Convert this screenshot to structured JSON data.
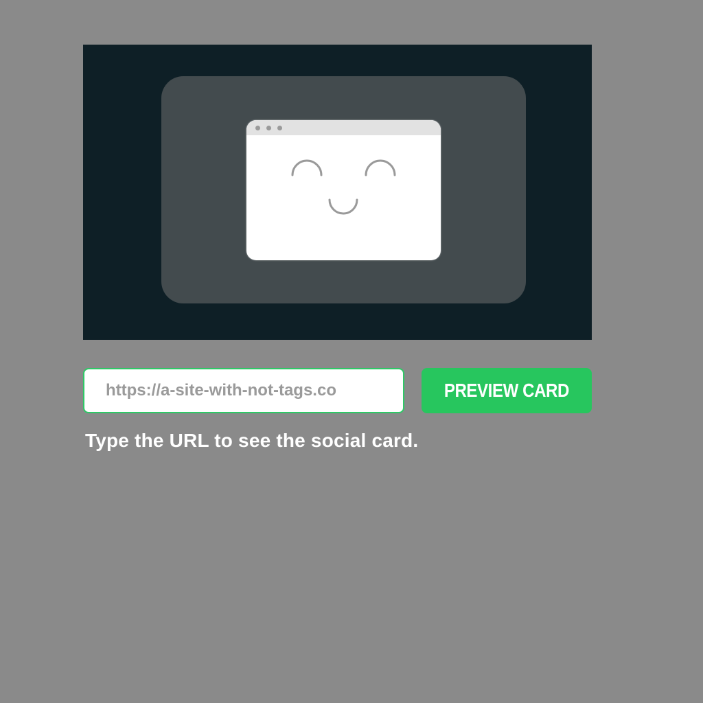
{
  "preview": {
    "image_icon": "smiling-browser-window-icon",
    "colors": {
      "background": "#0e1f26",
      "frame": "#434b4e",
      "window": "#ffffff"
    }
  },
  "url_input": {
    "placeholder": "https://a-site-with-not-tags.co",
    "value": ""
  },
  "preview_button": {
    "label": "PREVIEW CARD",
    "color": "#27c65e"
  },
  "help_text": "Type the URL to see the social card.",
  "colors": {
    "page_background": "#8a8a8a",
    "accent": "#2ec866"
  }
}
